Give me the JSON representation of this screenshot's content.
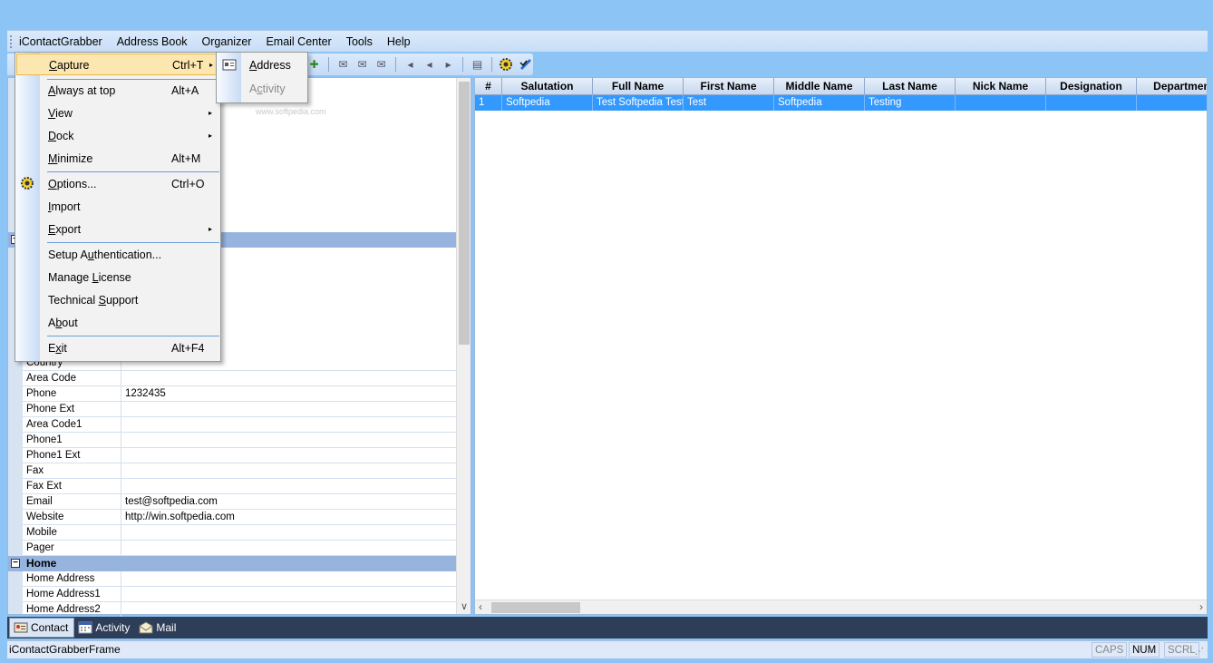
{
  "menubar": [
    "iContactGrabber",
    "Address Book",
    "Organizer",
    "Email Center",
    "Tools",
    "Help"
  ],
  "grid": {
    "rows": [
      {
        "key": "Country",
        "value": ""
      },
      {
        "key": "Area Code",
        "value": ""
      },
      {
        "key": "Phone",
        "value": "1232435"
      },
      {
        "key": "Phone Ext",
        "value": ""
      },
      {
        "key": "Area Code1",
        "value": ""
      },
      {
        "key": "Phone1",
        "value": ""
      },
      {
        "key": "Phone1 Ext",
        "value": ""
      },
      {
        "key": "Fax",
        "value": ""
      },
      {
        "key": "Fax Ext",
        "value": ""
      },
      {
        "key": "Email",
        "value": "test@softpedia.com"
      },
      {
        "key": "Website",
        "value": "http://win.softpedia.com"
      },
      {
        "key": "Mobile",
        "value": ""
      },
      {
        "key": "Pager",
        "value": ""
      }
    ],
    "home_category": "Home",
    "home_rows": [
      {
        "key": "Home Address",
        "value": ""
      },
      {
        "key": "Home Address1",
        "value": ""
      },
      {
        "key": "Home Address2",
        "value": ""
      }
    ]
  },
  "table": {
    "columns": [
      "#",
      "Salutation",
      "Full Name",
      "First Name",
      "Middle Name",
      "Last Name",
      "Nick Name",
      "Designation",
      "Departmen"
    ],
    "rows": [
      [
        "1",
        "Softpedia",
        "Test Softpedia Testi",
        "Test",
        "Softpedia",
        "Testing",
        "",
        "",
        ""
      ]
    ]
  },
  "tabs": [
    {
      "label": "Contact",
      "active": true
    },
    {
      "label": "Activity",
      "active": false
    },
    {
      "label": "Mail",
      "active": false
    }
  ],
  "status": {
    "text": "iContactGrabberFrame",
    "caps": "CAPS",
    "num": "NUM",
    "scrl": "SCRL"
  },
  "menu": {
    "capture": {
      "pre": "",
      "u": "C",
      "post": "apture",
      "shortcut": "Ctrl+T"
    },
    "always_on_top": {
      "pre": "",
      "u": "A",
      "post": "lways at top",
      "shortcut": "Alt+A"
    },
    "view": {
      "pre": "",
      "u": "V",
      "post": "iew"
    },
    "dock": {
      "pre": "",
      "u": "D",
      "post": "ock"
    },
    "minimize": {
      "pre": "",
      "u": "M",
      "post": "inimize",
      "shortcut": "Alt+M"
    },
    "options": {
      "pre": "",
      "u": "O",
      "post": "ptions...",
      "shortcut": "Ctrl+O"
    },
    "import": {
      "pre": "",
      "u": "I",
      "post": "mport"
    },
    "export": {
      "pre": "",
      "u": "E",
      "post": "xport"
    },
    "setup_auth": {
      "pre": "Setup A",
      "u": "u",
      "post": "thentication..."
    },
    "manage_license": {
      "pre": "Manage ",
      "u": "L",
      "post": "icense"
    },
    "tech_support": {
      "pre": "Technical ",
      "u": "S",
      "post": "upport"
    },
    "about": {
      "pre": "A",
      "u": "b",
      "post": "out"
    },
    "exit": {
      "pre": "E",
      "u": "x",
      "post": "it",
      "shortcut": "Alt+F4"
    }
  },
  "submenu": {
    "address": {
      "pre": "",
      "u": "A",
      "post": "ddress"
    },
    "activity": {
      "pre": "A",
      "u": "c",
      "post": "tivity"
    }
  },
  "watermark": "www.softpedia.com",
  "icons": {
    "arrow": "▸",
    "menu_gear": "gear-icon"
  },
  "colors": {
    "accent": "#3399ff",
    "menu_highlight": "#fde7b0",
    "category": "#97b4df"
  }
}
